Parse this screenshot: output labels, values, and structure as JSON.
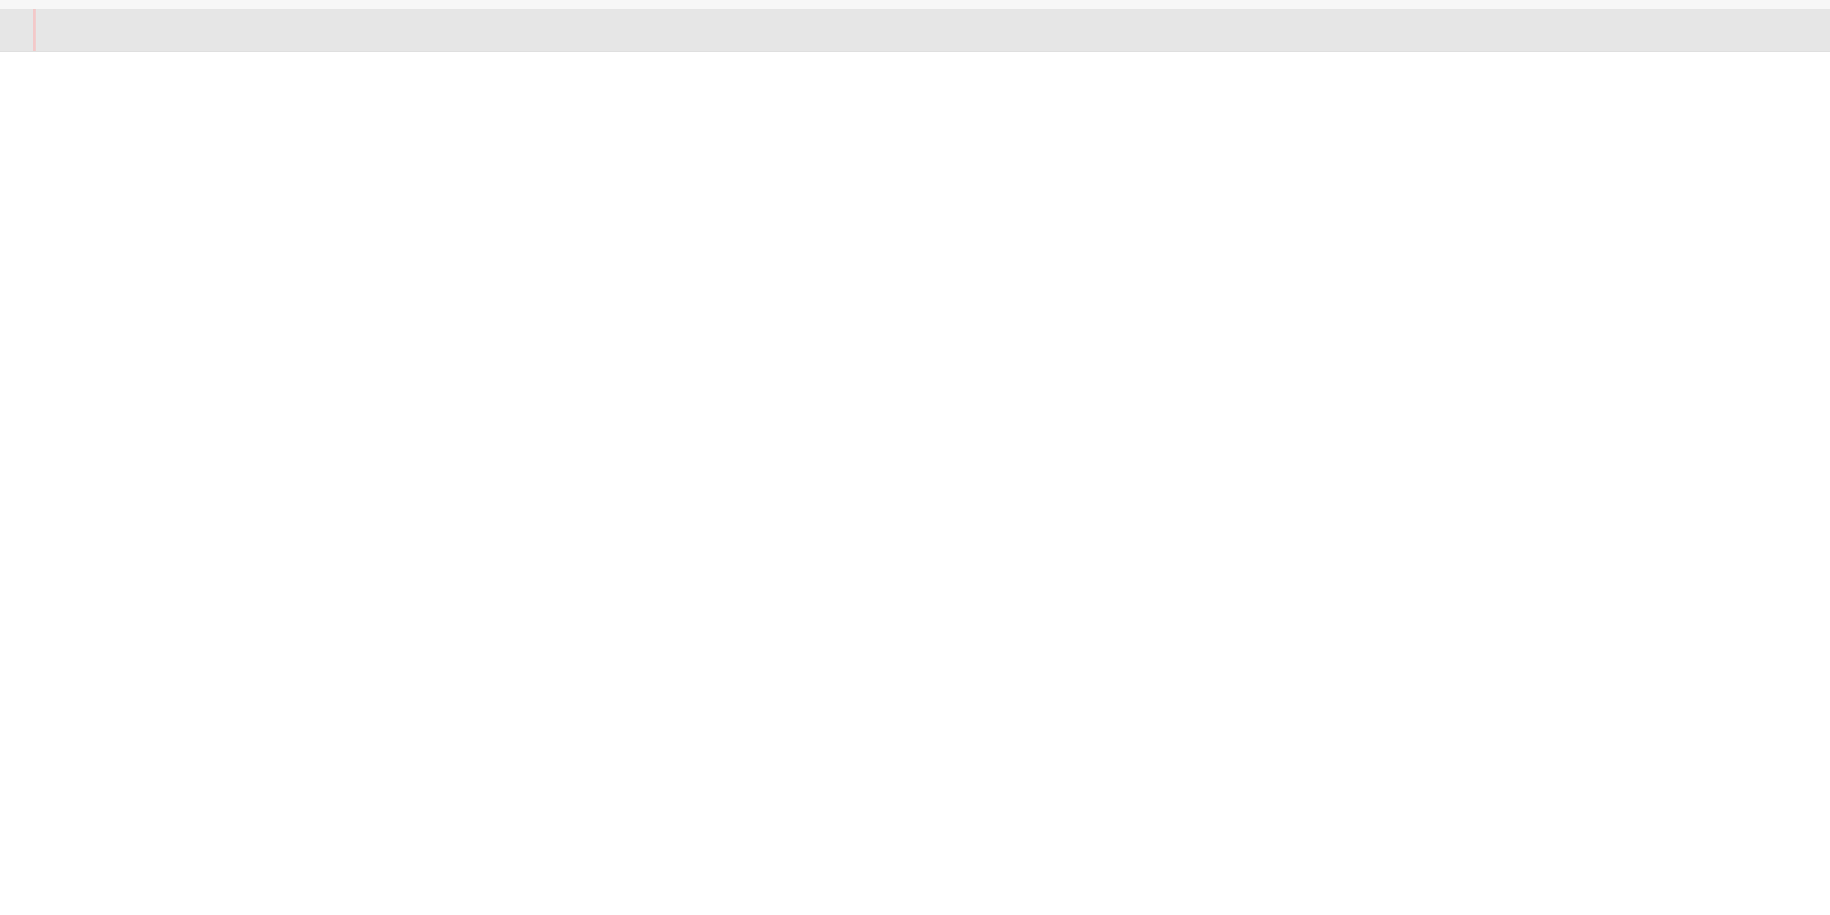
{
  "colors": {
    "background": "#ffffff",
    "top_strip": "#f7f7f7",
    "toolbar": "#e6e6e6",
    "toolbar_border": "#dcdcdc",
    "edge_marker": "#f3c9c9"
  }
}
